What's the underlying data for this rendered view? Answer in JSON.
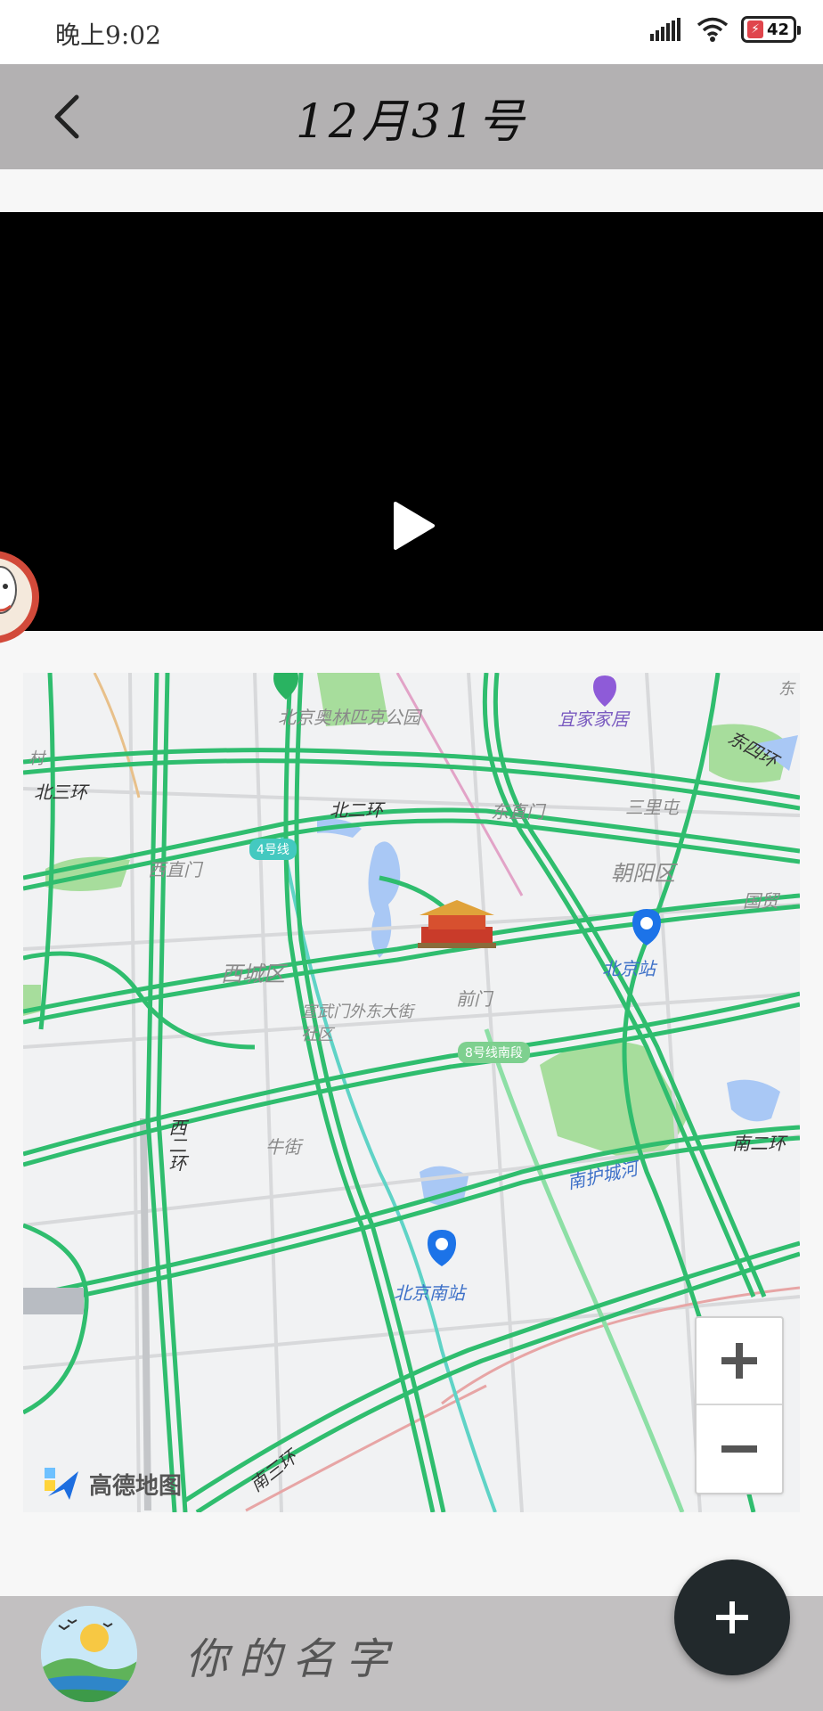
{
  "status_bar": {
    "time": "晚上9:02",
    "battery_level": "42",
    "signal_icon": "signal-icon",
    "wifi_icon": "wifi-icon"
  },
  "header": {
    "title": "12月31号",
    "back_icon": "back-arrow-icon",
    "background_color": "#b3b1b2"
  },
  "video": {
    "play_icon": "play-icon",
    "background_color": "#000000"
  },
  "map": {
    "provider_logo": "高德地图",
    "labels": {
      "beijing_olympic_park": "北京奥林匹克公园",
      "ikea": "宜家家居",
      "north_third_ring": "北三环",
      "north_second_ring": "北二环",
      "east_fourth_ring": "东四环",
      "dongzhimen": "东直门",
      "sanlitun": "三里屯",
      "xizhimen": "西直门",
      "chaoyang_district": "朝阳区",
      "guomao": "国贸",
      "xicheng_district": "西城区",
      "beijing_station": "北京站",
      "xuanwumenwai": "宣武门外东大街社区",
      "qianmen": "前门",
      "line4": "4号线",
      "line8_south": "8号线南段",
      "west_second_ring": "西二环",
      "niujie": "牛街",
      "south_moat": "南护城河",
      "south_second_ring": "南二环",
      "beijing_south_station": "北京南站",
      "south_third_ring": "南三环",
      "village": "村",
      "east": "东"
    },
    "colors": {
      "road": "#2fbd6e",
      "water": "#a9c8f5",
      "park": "#a7dd9c",
      "background": "#f1f2f3"
    },
    "zoom_in_icon": "plus-icon",
    "zoom_out_icon": "minus-icon"
  },
  "footer": {
    "user_name": "你的名字",
    "avatar_icon": "landscape-avatar",
    "fab_icon": "plus-icon",
    "background_color": "#c2c0c1",
    "fab_color": "#22292c"
  }
}
